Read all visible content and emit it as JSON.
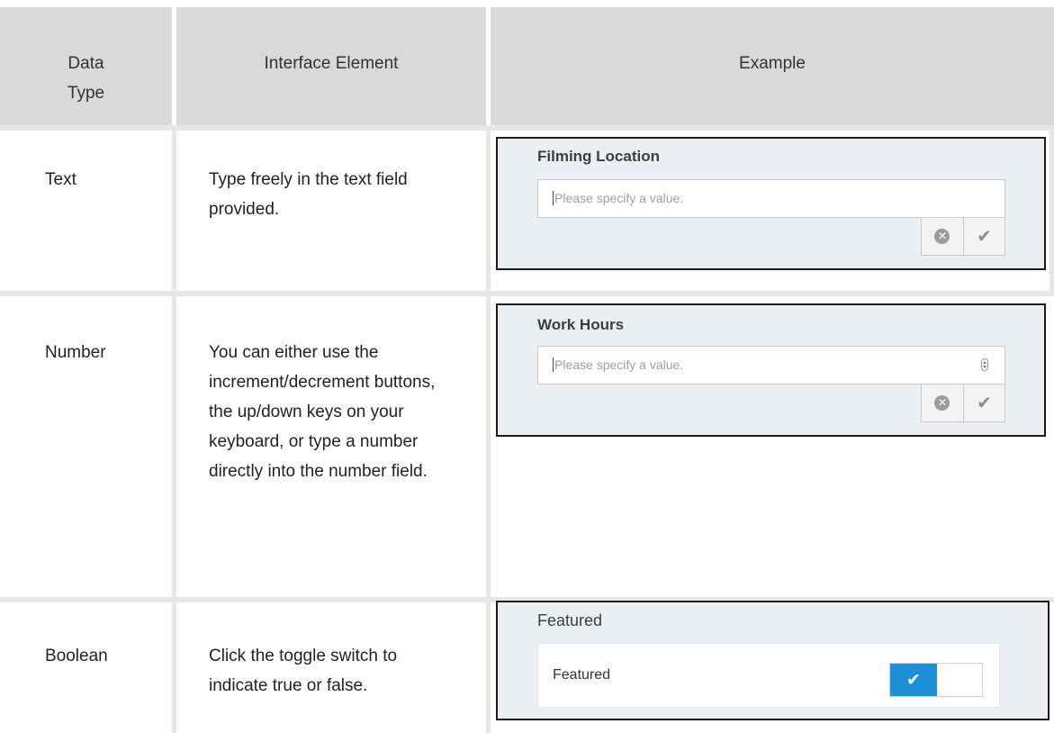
{
  "table": {
    "headers": [
      "Data\nType",
      "Interface Element",
      "Example"
    ],
    "rows": [
      {
        "type": "Text",
        "description": "Type freely in the text field provided.",
        "example": {
          "field_label": "Filming Location",
          "placeholder": "Please specify a value.",
          "clear_icon": "clear-circle-icon",
          "confirm_icon": "checkmark-icon"
        }
      },
      {
        "type": "Number",
        "description": "You can either use the increment/decrement buttons, the up/down keys on your keyboard, or type a number directly into the number field.",
        "example": {
          "field_label": "Work Hours",
          "placeholder": "Please specify a value.",
          "spinner_icon": "increment-decrement-icon",
          "clear_icon": "clear-circle-icon",
          "confirm_icon": "checkmark-icon"
        }
      },
      {
        "type": "Boolean",
        "description": "Click the toggle switch to indicate true or false.",
        "example": {
          "field_label": "Featured",
          "toggle_label": "Featured",
          "toggle_state": "on",
          "toggle_icon": "checkmark-icon"
        }
      }
    ]
  },
  "colors": {
    "header_bg": "#d9d9d9",
    "example_bg": "#ebeff3",
    "toggle_on": "#1c8fd6"
  }
}
